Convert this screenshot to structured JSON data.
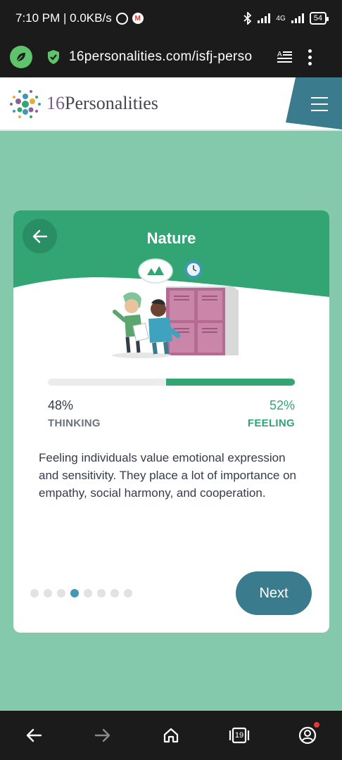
{
  "status_bar": {
    "time_speed": "7:10 PM | 0.0KB/s",
    "network": "4G",
    "battery": "54",
    "icons": [
      "alarm-icon",
      "gmail-icon",
      "bluetooth-icon",
      "signal-icon",
      "battery-icon"
    ]
  },
  "browser": {
    "url": "16personalities.com/isfj-perso",
    "icons": [
      "leaf-icon",
      "shield-check-icon",
      "reader-mode-icon",
      "more-vert-icon"
    ]
  },
  "site": {
    "logo_num": "16",
    "logo_word": "Personalities"
  },
  "card": {
    "title": "Nature",
    "left_percent": "48%",
    "right_percent": "52%",
    "left_trait": "THINKING",
    "right_trait": "FEELING",
    "progress_right_fraction": 0.52,
    "description": "Feeling individuals value emotional expression and sensitivity. They place a lot of importance on empathy, social harmony, and cooperation.",
    "dots_total": 8,
    "dots_active_index": 3,
    "next_label": "Next"
  },
  "bottom_nav": {
    "tabs_count": "19",
    "icons": [
      "back-arrow-icon",
      "forward-arrow-icon",
      "home-icon",
      "tabs-icon",
      "account-icon"
    ]
  },
  "colors": {
    "page_bg": "#85c9ac",
    "accent_green": "#33a474",
    "next_button": "#3a7b8d",
    "active_dot": "#4298b4"
  }
}
